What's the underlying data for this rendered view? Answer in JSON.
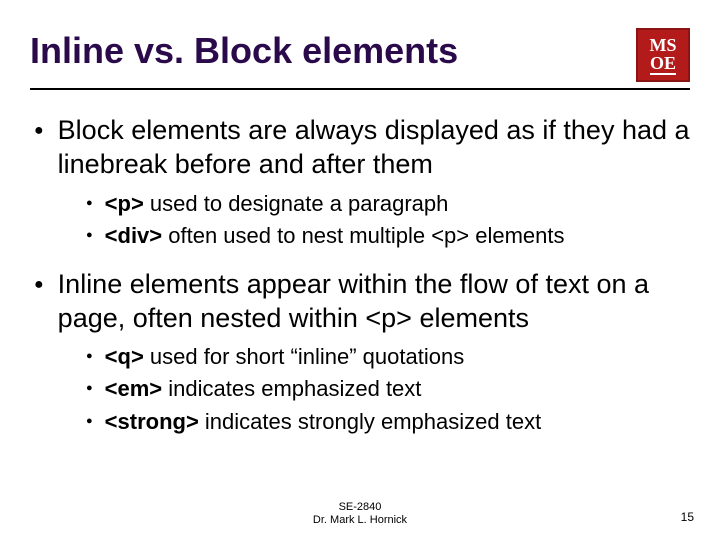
{
  "title": "Inline vs. Block elements",
  "logo": {
    "line1": "MS",
    "line2": "OE"
  },
  "bullets": [
    {
      "text": "Block elements are always displayed as if they had a linebreak before and after them",
      "sub": [
        {
          "tag": "<p>",
          "rest": " used to designate a paragraph"
        },
        {
          "tag": "<div>",
          "rest": " often used to nest multiple <p> elements"
        }
      ]
    },
    {
      "text": "Inline elements appear within the flow of text on a page, often nested within <p> elements",
      "sub": [
        {
          "tag": "<q>",
          "rest": " used for short “inline” quotations"
        },
        {
          "tag": "<em>",
          "rest": " indicates emphasized text"
        },
        {
          "tag": "<strong>",
          "rest": " indicates strongly emphasized text"
        }
      ]
    }
  ],
  "footer": {
    "course": "SE-2840",
    "author": "Dr. Mark L. Hornick"
  },
  "page": "15"
}
